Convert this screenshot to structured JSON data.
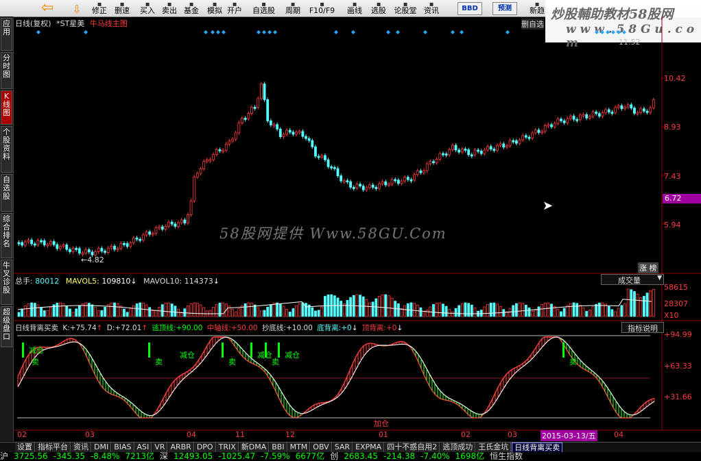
{
  "toolbar": {
    "buttons": [
      "修正",
      "删速",
      "买入",
      "卖出",
      "基金",
      "模拟",
      "开户",
      "自选股",
      "周期",
      "F10/F9",
      "画线",
      "选股",
      "论股堂",
      "资讯",
      "新趋"
    ],
    "boxes": [
      "BBD",
      "预测"
    ]
  },
  "watermark": {
    "line1": "炒股輔助教材58股网",
    "line2": "w w w . 5 8 G u . c o m"
  },
  "sidetabs": [
    {
      "label": "应用",
      "active": false
    },
    {
      "label": "分时图",
      "active": false
    },
    {
      "label": "K线图",
      "active": true
    },
    {
      "label": "个股资料",
      "active": false
    },
    {
      "label": "自选股",
      "active": false
    },
    {
      "label": "综合排名",
      "active": false
    },
    {
      "label": "牛叉诊股",
      "active": false
    },
    {
      "label": "超级盘口",
      "active": false
    }
  ],
  "header": {
    "period": "日线(复权)",
    "stock": "*ST星美",
    "indicator": "牛马线主图",
    "right_label": "删自选"
  },
  "price_axis": {
    "labels": [
      "10.42",
      "8.93",
      "7.43",
      "5.94"
    ],
    "current": "6.72",
    "top_partial": "11.52"
  },
  "low_label": "←4.82",
  "limit_badge": "涨 榜",
  "site_watermark": "58股网提供 Www.58GU.Com",
  "volume": {
    "total_label": "总手:",
    "total": "80012",
    "ma5_label": "MAVOL5:",
    "ma5": "109810",
    "ma10_label": "MAVOL10:",
    "ma10": "114373",
    "selector": "成交量",
    "axis": [
      "58615",
      "28307",
      "X10"
    ]
  },
  "indicator": {
    "name": "日线背离买卖",
    "k_label": "K:",
    "k": "+75.74",
    "d_label": "D:",
    "d": "+72.01",
    "escape_label": "逃顶线:",
    "escape": "+90.00",
    "mid_label": "中轴线:",
    "mid": "+50.00",
    "bottom_label": "抄底线:",
    "bottom": "+10.00",
    "div_bottom_label": "底背离:",
    "div_bottom": "+0",
    "div_top_label": "顶背离:",
    "div_top": "+0",
    "help": "指标说明",
    "axis": [
      "+94.99",
      "+63.33",
      "+31.66"
    ],
    "signals": [
      {
        "text": "减仓",
        "col": 12
      },
      {
        "text": "卖",
        "col": 16
      },
      {
        "text": "卖",
        "col": 196
      },
      {
        "text": "减仓",
        "col": 232
      },
      {
        "text": "卖",
        "col": 303
      },
      {
        "text": "减仓",
        "col": 345
      },
      {
        "text": "卖",
        "col": 366
      },
      {
        "text": "减仓",
        "col": 385
      },
      {
        "text": "卖",
        "col": 800
      },
      {
        "text": "加仓",
        "col": 515
      }
    ]
  },
  "time_axis": {
    "labels": [
      "02",
      "03",
      "04",
      "11",
      "12",
      "01",
      "02",
      "03",
      "04"
    ],
    "highlight": "2015-03-13/五"
  },
  "tabbar": [
    "设置",
    "指标平台",
    "资讯",
    "DMI",
    "BIAS",
    "ASI",
    "VR",
    "ARBR",
    "DPO",
    "TRIX",
    "新DMA",
    "BBI",
    "MTM",
    "OBV",
    "SAR",
    "EXPMA",
    "四十不惑自用2",
    "逃顶成功",
    "王氏金坑",
    "日线背离买卖"
  ],
  "tabbar_active": "日线背离买卖",
  "ticker": "沪 3725.56 -345.35 -8.48% 7213亿 深 12493.05 -1025.47 -7.59% 6677亿 创 2683.45 -214.38 -7.40% 1698亿 恒生指数",
  "colors": {
    "up": "#ff3c3c",
    "down": "#54ffff",
    "axis": "#a00000",
    "signal": "#00ff00",
    "diamond": "#2aa8ff"
  }
}
